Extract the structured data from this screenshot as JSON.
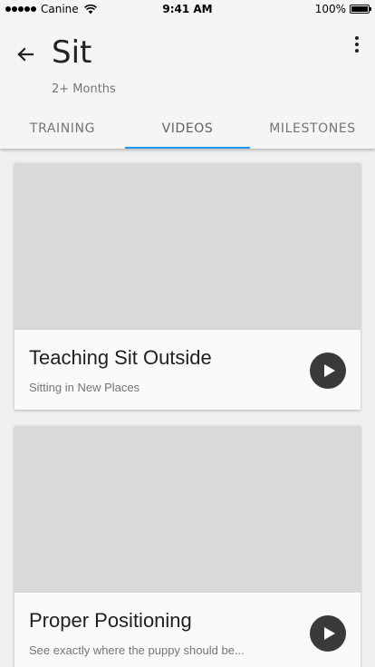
{
  "status_bar": {
    "carrier": "Canine",
    "time": "9:41 AM",
    "battery": "100%"
  },
  "header": {
    "title": "Sit",
    "subtitle": "2+ Months",
    "back_icon": "arrow-left-icon",
    "menu_icon": "more-vertical-icon"
  },
  "tabs": [
    {
      "label": "TRAINING",
      "active": false
    },
    {
      "label": "VIDEOS",
      "active": true
    },
    {
      "label": "MILESTONES",
      "active": false
    }
  ],
  "colors": {
    "accent": "#2196f3",
    "play_button": "#3a3a3a",
    "thumbnail": "#d9d9d9"
  },
  "videos": [
    {
      "title": "Teaching Sit Outside",
      "subtitle": "Sitting in New Places"
    },
    {
      "title": "Proper Positioning",
      "subtitle": "See exactly where the puppy should be..."
    }
  ]
}
